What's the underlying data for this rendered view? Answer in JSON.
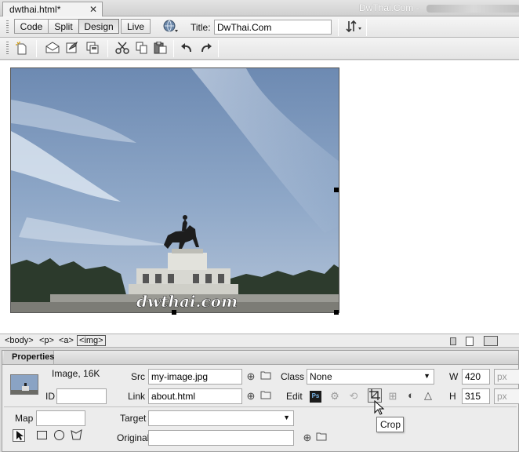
{
  "tab": {
    "filename": "dwthai.html*",
    "close_glyph": "✕",
    "site_title": "DwThai.Com - "
  },
  "doc_toolbar": {
    "views": [
      "Code",
      "Split",
      "Design",
      "Live"
    ],
    "active_view": "Design",
    "title_label": "Title:",
    "title_value": "DwThai.Com"
  },
  "std_toolbar": {
    "icons": [
      "new-document-icon",
      "open-icon",
      "save-icon",
      "save-all-icon",
      "cut-icon",
      "copy-icon",
      "paste-icon",
      "undo-icon",
      "redo-icon"
    ]
  },
  "design": {
    "image_watermark": "dwthai.com",
    "image_width": 420,
    "image_height": 315
  },
  "tag_selector": {
    "tags": [
      "<body>",
      "<p>",
      "<a>",
      "<img>"
    ],
    "selected": "<img>"
  },
  "properties": {
    "tab_label": "Properties",
    "image_info": "Image, 16K",
    "id_label": "ID",
    "id_value": "",
    "src_label": "Src",
    "src_value": "my-image.jpg",
    "link_label": "Link",
    "link_value": "about.html",
    "class_label": "Class",
    "class_value": "None",
    "edit_label": "Edit",
    "w_label": "W",
    "w_value": "420",
    "h_label": "H",
    "h_value": "315",
    "unit": "px",
    "map_label": "Map",
    "map_value": "",
    "target_label": "Target",
    "target_value": "",
    "original_label": "Original",
    "original_value": ""
  },
  "tooltip": {
    "text": "Crop"
  },
  "colors": {
    "sky_top": "#6f8db6",
    "sky_bottom": "#a9bfd9",
    "photoshop_badge": "#1c1c1c"
  }
}
